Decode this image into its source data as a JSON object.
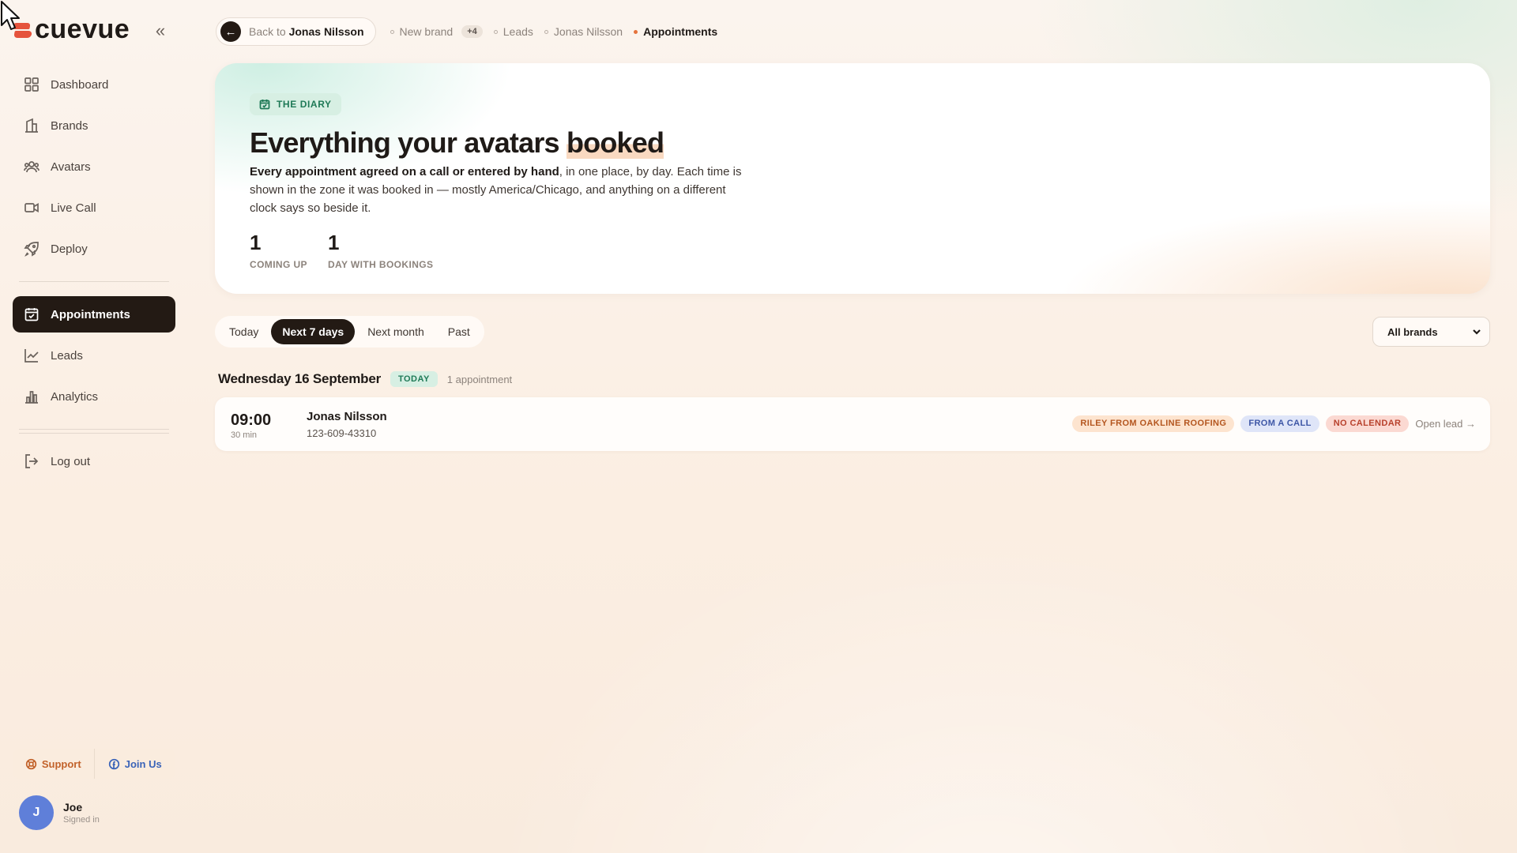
{
  "app": {
    "name": "cuevue"
  },
  "sidebar": {
    "collapse_glyph": "«",
    "items_primary": [
      {
        "label": "Dashboard",
        "icon": "dashboard-icon"
      },
      {
        "label": "Brands",
        "icon": "building-icon"
      },
      {
        "label": "Avatars",
        "icon": "users-icon"
      },
      {
        "label": "Live Call",
        "icon": "video-icon"
      },
      {
        "label": "Deploy",
        "icon": "rocket-icon"
      }
    ],
    "items_secondary": [
      {
        "label": "Appointments",
        "icon": "calendar-check-icon",
        "active": true
      },
      {
        "label": "Leads",
        "icon": "trend-icon"
      },
      {
        "label": "Analytics",
        "icon": "bar-chart-icon"
      }
    ],
    "logout": {
      "label": "Log out",
      "icon": "logout-icon"
    },
    "support_label": "Support",
    "join_label": "Join Us",
    "user": {
      "initial": "J",
      "name": "Joe",
      "status": "Signed in"
    }
  },
  "breadcrumb": {
    "back_prefix": "Back to",
    "back_target": "Jonas Nilsson",
    "items": [
      {
        "label": "New brand",
        "badge": "+4"
      },
      {
        "label": "Leads"
      },
      {
        "label": "Jonas Nilsson"
      },
      {
        "label": "Appointments",
        "current": true
      }
    ]
  },
  "hero": {
    "tag": "THE DIARY",
    "title_main": "Everything your avatars ",
    "title_highlight": "booked",
    "desc_bold": "Every appointment agreed on a call or entered by hand",
    "desc_rest": ", in one place, by day. Each time is shown in the zone it was booked in — mostly America/Chicago, and anything on a different clock says so beside it.",
    "stats": [
      {
        "value": "1",
        "label": "COMING UP"
      },
      {
        "value": "1",
        "label": "DAY WITH BOOKINGS"
      }
    ]
  },
  "filters": {
    "tabs": [
      {
        "label": "Today"
      },
      {
        "label": "Next 7 days",
        "active": true
      },
      {
        "label": "Next month"
      },
      {
        "label": "Past"
      }
    ],
    "brand_select": "All brands"
  },
  "day_groups": [
    {
      "title": "Wednesday 16 September",
      "badge": "TODAY",
      "count": "1 appointment",
      "appointments": [
        {
          "time": "09:00",
          "duration": "30 min",
          "name": "Jonas Nilsson",
          "phone": "123-609-43310",
          "brand_tag": "RILEY FROM OAKLINE ROOFING",
          "source_tag": "FROM A CALL",
          "calendar_tag": "NO CALENDAR",
          "action": "Open lead →"
        }
      ]
    }
  ],
  "colors": {
    "accent_dark": "#231a14",
    "brand_red": "#e5533c",
    "green_tag": "#1f7a57",
    "avatar_blue": "#5f7fd9"
  }
}
